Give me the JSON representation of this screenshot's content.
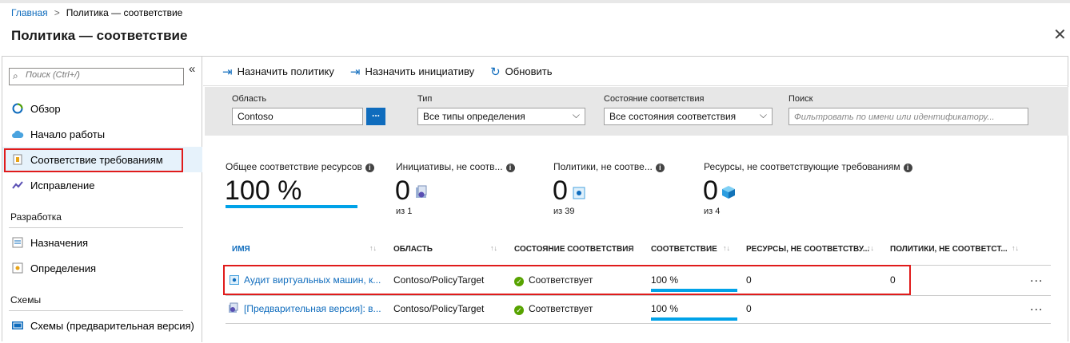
{
  "breadcrumb": {
    "home": "Главная",
    "current": "Политика — соответствие"
  },
  "page_title": "Политика — соответствие",
  "sidebar": {
    "search_placeholder": "Поиск (Ctrl+/)",
    "items": [
      {
        "label": "Обзор",
        "icon": "overview-icon"
      },
      {
        "label": "Начало работы",
        "icon": "cloud-icon"
      },
      {
        "label": "Соответствие требованиям",
        "icon": "compliance-icon",
        "active": true
      },
      {
        "label": "Исправление",
        "icon": "remediation-icon"
      }
    ],
    "section_dev": "Разработка",
    "dev_items": [
      {
        "label": "Назначения",
        "icon": "assignments-icon"
      },
      {
        "label": "Определения",
        "icon": "definitions-icon"
      }
    ],
    "section_blueprints": "Схемы",
    "blueprint_items": [
      {
        "label": "Схемы (предварительная версия)",
        "icon": "blueprints-icon"
      }
    ]
  },
  "toolbar": {
    "assign_policy": "Назначить политику",
    "assign_initiative": "Назначить инициативу",
    "refresh": "Обновить"
  },
  "filters": {
    "scope_label": "Область",
    "scope_value": "Contoso",
    "scope_button": "...",
    "type_label": "Тип",
    "type_value": "Все типы определения",
    "state_label": "Состояние соответствия",
    "state_value": "Все состояния соответствия",
    "search_label": "Поиск",
    "search_placeholder": "Фильтровать по имени или идентификатору..."
  },
  "stats": {
    "overall_label": "Общее соответствие ресурсов",
    "overall_value": "100 %",
    "overall_percent": 100,
    "initiatives_label": "Инициативы, не соотв...",
    "initiatives_value": "0",
    "initiatives_total": "из 1",
    "policies_label": "Политики, не соотве...",
    "policies_value": "0",
    "policies_total": "из 39",
    "resources_label": "Ресурсы, не соответствующие требованиям",
    "resources_value": "0",
    "resources_total": "из 4"
  },
  "table": {
    "headers": [
      "ИМЯ",
      "ОБЛАСТЬ",
      "СОСТОЯНИЕ СООТВЕТСТВИЯ",
      "СООТВЕТСТВИЕ",
      "РЕСУРСЫ, НЕ СООТВЕТСТВУ...",
      "ПОЛИТИКИ, НЕ СООТВЕТСТ..."
    ],
    "rows": [
      {
        "name": "Аудит виртуальных машин, к...",
        "scope": "Contoso/PolicyTarget",
        "state": "Соответствует",
        "compliance": "100 %",
        "compliance_percent": 100,
        "resources": "0",
        "policies": "0",
        "more": "..."
      },
      {
        "name": "[Предварительная версия]: в...",
        "scope": "Contoso/PolicyTarget",
        "state": "Соответствует",
        "compliance": "100 %",
        "compliance_percent": 100,
        "resources": "0",
        "policies": "",
        "more": "..."
      }
    ]
  },
  "colors": {
    "accent": "#0f6cbd",
    "progress": "#00a2e8",
    "ok": "#57a300",
    "highlight": "#e01b1b"
  }
}
